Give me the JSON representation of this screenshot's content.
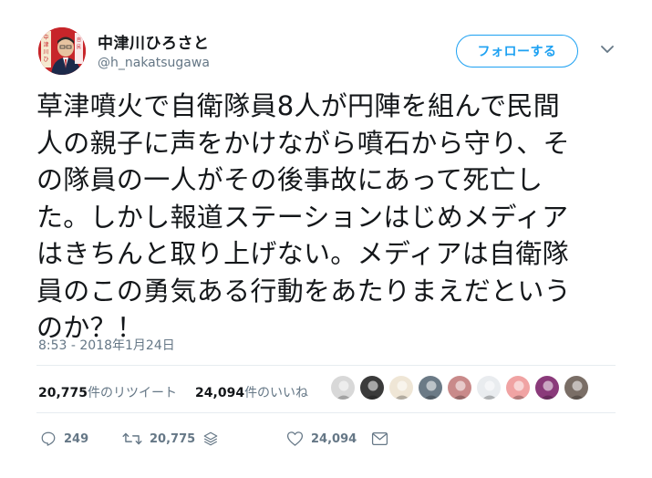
{
  "user": {
    "display_name": "中津川ひろさと",
    "handle": "@h_nakatsugawa",
    "avatar_label": "中津川ひろさと"
  },
  "follow_button": {
    "label": "フォローする"
  },
  "tweet": {
    "text": "草津噴火で自衛隊員8人が円陣を組んで民間\n人の親子に声をかけながら噴石から守り、そ\nの隊員の一人がその後事故にあって死亡し\nた。しかし報道ステーションはじめメディア\nはきちんと取り上げない。メディアは自衛隊\n員のこの勇気ある行動をあたりまえだという\nのか？！",
    "timestamp": "8:53 - 2018年1月24日"
  },
  "stats": {
    "retweets_count": "20,775",
    "retweets_label": "件のリツイート",
    "likes_count": "24,094",
    "likes_label": "件のいいね"
  },
  "likers": [
    {
      "icon": "liker-avatar-1",
      "color": "#d8d8d8"
    },
    {
      "icon": "liker-avatar-2",
      "color": "#3a3a3a"
    },
    {
      "icon": "liker-avatar-3",
      "color": "#efe6d6"
    },
    {
      "icon": "liker-avatar-4",
      "color": "#6b7a86"
    },
    {
      "icon": "liker-avatar-5",
      "color": "#c98a8a"
    },
    {
      "icon": "liker-avatar-6",
      "color": "#e9ecef"
    },
    {
      "icon": "liker-avatar-7",
      "color": "#f0a3a3"
    },
    {
      "icon": "liker-avatar-8",
      "color": "#8a3a7a"
    },
    {
      "icon": "liker-avatar-9",
      "color": "#7a6e66"
    }
  ],
  "actions": {
    "reply_count": "249",
    "retweet_count": "20,775",
    "like_count": "24,094"
  },
  "colors": {
    "accent": "#1da1f2",
    "secondary_text": "#657786",
    "avatar_bg": "#c7252a"
  }
}
